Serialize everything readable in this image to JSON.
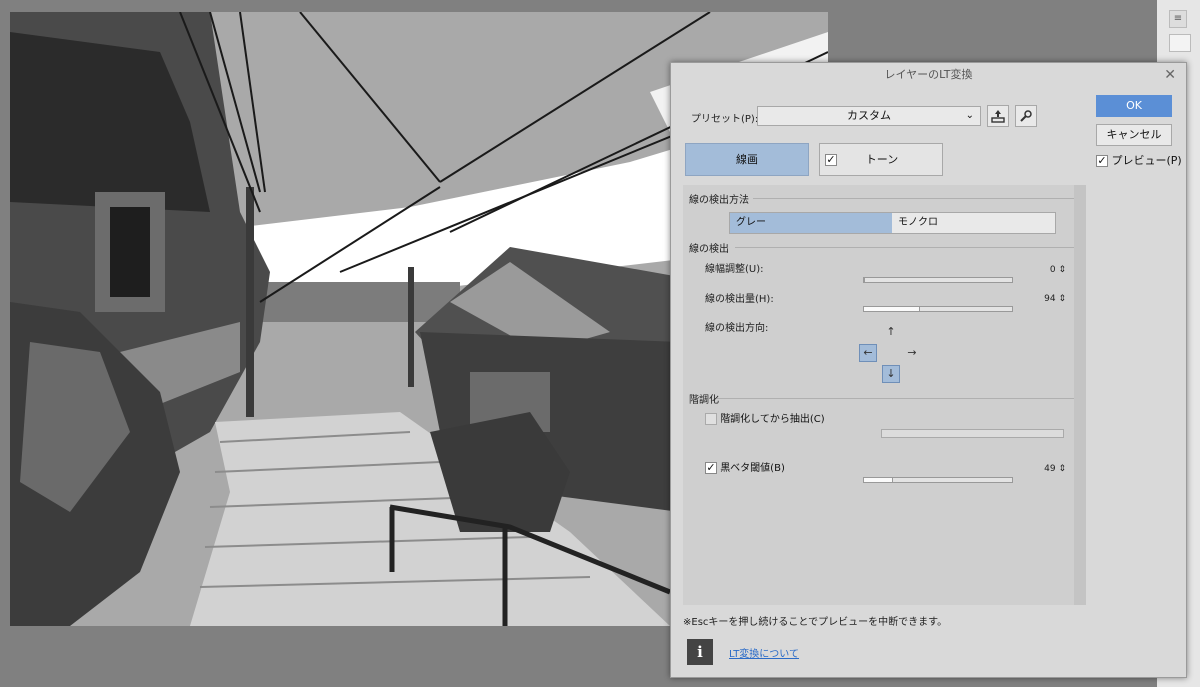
{
  "dialog": {
    "title": "レイヤーのLT変換",
    "close": "✕",
    "preset_label": "プリセット(P):",
    "preset_value": "カスタム",
    "ok": "OK",
    "cancel": "キャンセル",
    "preview": "プレビュー(P)",
    "preview_checked": "✓",
    "tab_line": "線画",
    "tab_tone": "トーン",
    "tab_tone_checked": "✓"
  },
  "line_detection_method": {
    "title": "線の検出方法",
    "options": [
      "グレー",
      "モノクロ"
    ],
    "selected": "グレー"
  },
  "line_detection": {
    "title": "線の検出",
    "width_adjust": {
      "label": "線幅調整(U):",
      "value": "0",
      "level": 0
    },
    "amount": {
      "label": "線の検出量(H):",
      "value": "94",
      "level": 0.37
    },
    "direction": {
      "label": "線の検出方向:",
      "selected": [
        "left",
        "down"
      ]
    }
  },
  "gradation": {
    "title": "階調化",
    "extract_after": {
      "label": "階調化してから抽出(C)",
      "checked": ""
    },
    "black_threshold": {
      "label": "黒ベタ閾値(B)",
      "checked": "✓",
      "value": "49",
      "level": 0.19
    }
  },
  "footer": {
    "note": "※Escキーを押し続けることでプレビューを中断できます。",
    "info_icon": "i",
    "link": "LT変換について"
  },
  "icons": {
    "save_preset": "save-preset-icon",
    "settings": "wrench-icon",
    "dropdown": "chevron-down-icon",
    "arrow_up": "↑",
    "arrow_down": "↓",
    "arrow_left": "←",
    "arrow_right": "→"
  },
  "side_strip": {
    "menu": "≡"
  }
}
